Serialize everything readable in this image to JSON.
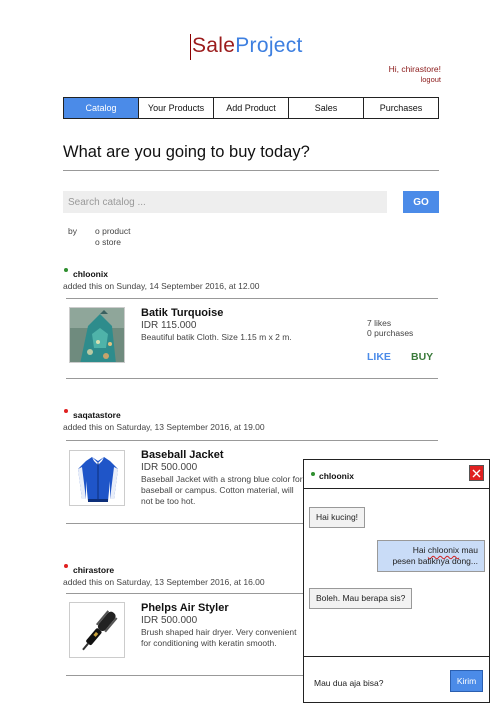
{
  "brand": {
    "part1": "Sale",
    "part2": "Project"
  },
  "user": {
    "greeting": "Hi, chirastore!",
    "logout": "logout"
  },
  "nav": {
    "tabs": [
      {
        "label": "Catalog",
        "active": true
      },
      {
        "label": "Your Products",
        "active": false
      },
      {
        "label": "Add Product",
        "active": false
      },
      {
        "label": "Sales",
        "active": false
      },
      {
        "label": "Purchases",
        "active": false
      }
    ]
  },
  "main": {
    "headline": "What are you going to buy today?",
    "search": {
      "placeholder": "Search catalog ...",
      "button": "GO"
    },
    "filter": {
      "by_label": "by",
      "options": [
        "o product",
        "o store"
      ]
    }
  },
  "listings": [
    {
      "seller": "chloonix",
      "seller_status_color": "#2f8f2f",
      "added": "added this on Sunday, 14 September 2016, at 12.00",
      "name": "Batik Turquoise",
      "price": "IDR 115.000",
      "description": "Beautiful batik Cloth. Size 1.15 m x 2 m.",
      "likes": "7 likes",
      "purchases": "0 purchases",
      "like_label": "LIKE",
      "buy_label": "BUY"
    },
    {
      "seller": "saqatastore",
      "seller_status_color": "#e02020",
      "added": "added this on Saturday, 13 September 2016, at 19.00",
      "name": "Baseball Jacket",
      "price": "IDR 500.000",
      "description": "Baseball Jacket with a strong blue color for baseball or campus. Cotton material, will not be too hot."
    },
    {
      "seller": "chirastore",
      "seller_status_color": "#e02020",
      "added": "added this on Saturday, 13 September 2016, at 16.00",
      "name": "Phelps Air Styler",
      "price": "IDR 500.000",
      "description": "Brush shaped hair dryer. Very convenient for conditioning with keratin smooth."
    }
  ],
  "chat": {
    "partner": "chloonix",
    "partner_status_color": "#2f8f2f",
    "messages": [
      {
        "side": "left",
        "text": "Hai kucing!"
      },
      {
        "side": "right",
        "line1_pre": "Hai ",
        "line1_underlined": "chloonix",
        "line1_post": " mau",
        "line2": "pesen batiknya dong..."
      },
      {
        "side": "left",
        "text": "Boleh. Mau berapa sis?"
      }
    ],
    "draft": "Mau dua aja bisa?",
    "send_label": "Kirim"
  },
  "colors": {
    "accent": "#4b8be8",
    "brand_red": "#9b1b1b",
    "buy_green": "#3a7a3a"
  }
}
